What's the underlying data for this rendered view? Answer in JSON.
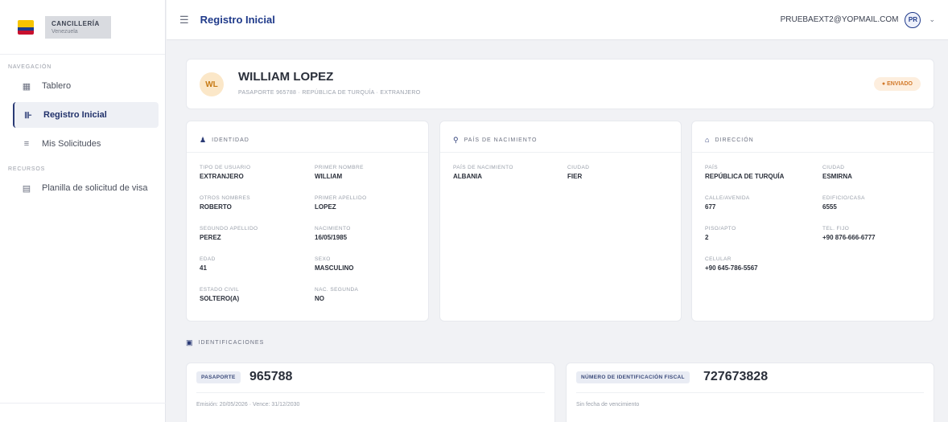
{
  "brand": {
    "name": "CANCILLERÍA",
    "sub": "Venezuela"
  },
  "sidebar": {
    "sections": [
      {
        "label": "NAVEGACIÓN",
        "items": [
          {
            "label": "Tablero",
            "icon": "dashboard-icon"
          },
          {
            "label": "Registro Inicial",
            "icon": "registry-icon"
          },
          {
            "label": "Mis Solicitudes",
            "icon": "list-icon"
          }
        ]
      },
      {
        "label": "RECURSOS",
        "items": [
          {
            "label": "Planilla de solicitud de visa",
            "icon": "document-icon"
          }
        ]
      }
    ]
  },
  "header": {
    "title": "Registro Inicial",
    "user_email": "PRUEBAEXT2@YOPMAIL.COM",
    "user_initials": "PR"
  },
  "profile": {
    "initials": "WL",
    "name": "WILLIAM LOPEZ",
    "subtitle": "PASAPORTE 965788 · REPÚBLICA DE TURQUÍA · EXTRANJERO",
    "status": "● ENVIADO"
  },
  "identidad": {
    "title": "IDENTIDAD",
    "fields": [
      {
        "label": "TIPO DE USUARIO",
        "value": "EXTRANJERO"
      },
      {
        "label": "PRIMER NOMBRE",
        "value": "WILLIAM"
      },
      {
        "label": "OTROS NOMBRES",
        "value": "ROBERTO"
      },
      {
        "label": "PRIMER APELLIDO",
        "value": "LOPEZ"
      },
      {
        "label": "SEGUNDO APELLIDO",
        "value": "PEREZ"
      },
      {
        "label": "NACIMIENTO",
        "value": "16/05/1985"
      },
      {
        "label": "EDAD",
        "value": "41"
      },
      {
        "label": "SEXO",
        "value": "MASCULINO"
      },
      {
        "label": "ESTADO CIVIL",
        "value": "SOLTERO(A)"
      },
      {
        "label": "NAC. SEGUNDA",
        "value": "NO"
      }
    ]
  },
  "nacimiento": {
    "title": "PAÍS DE NACIMIENTO",
    "fields": [
      {
        "label": "PAÍS DE NACIMIENTO",
        "value": "ALBANIA"
      },
      {
        "label": "Ciudad",
        "value": "FIER"
      }
    ]
  },
  "direccion": {
    "title": "DIRECCIÓN",
    "fields": [
      {
        "label": "PAÍS",
        "value": "REPÚBLICA DE TURQUÍA"
      },
      {
        "label": "Ciudad",
        "value": "ESMIRNA"
      },
      {
        "label": "CALLE/AVENIDA",
        "value": "677"
      },
      {
        "label": "EDIFICIO/CASA",
        "value": "6555"
      },
      {
        "label": "PISO/APTO",
        "value": "2"
      },
      {
        "label": "TEL. FIJO",
        "value": "+90 876-666-6777"
      },
      {
        "label": "CELULAR",
        "value": "+90 645-786-5567"
      }
    ]
  },
  "identificaciones": {
    "title": "IDENTIFICACIONES",
    "cards": [
      {
        "tag": "PASAPORTE",
        "number": "965788",
        "meta": "Emisión: 20/05/2026 · Vence: 31/12/2030"
      },
      {
        "tag": "NÚMERO DE IDENTIFICACIÓN FISCAL",
        "number": "727673828",
        "meta": "Sin fecha de vencimiento"
      }
    ]
  }
}
